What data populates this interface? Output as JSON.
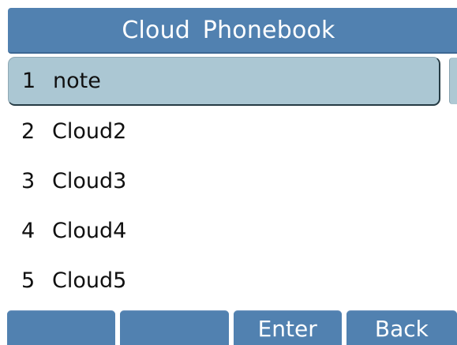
{
  "header": {
    "title": "Cloud  Phonebook"
  },
  "list": {
    "items": [
      {
        "num": "1",
        "name": "note"
      },
      {
        "num": "2",
        "name": "Cloud2"
      },
      {
        "num": "3",
        "name": "Cloud3"
      },
      {
        "num": "4",
        "name": "Cloud4"
      },
      {
        "num": "5",
        "name": "Cloud5"
      }
    ],
    "selected_index": 0
  },
  "softkeys": [
    "",
    "",
    "Enter",
    "Back"
  ],
  "colors": {
    "accent": "#5181b0",
    "selection": "#abc7d3",
    "text": "#101010"
  }
}
